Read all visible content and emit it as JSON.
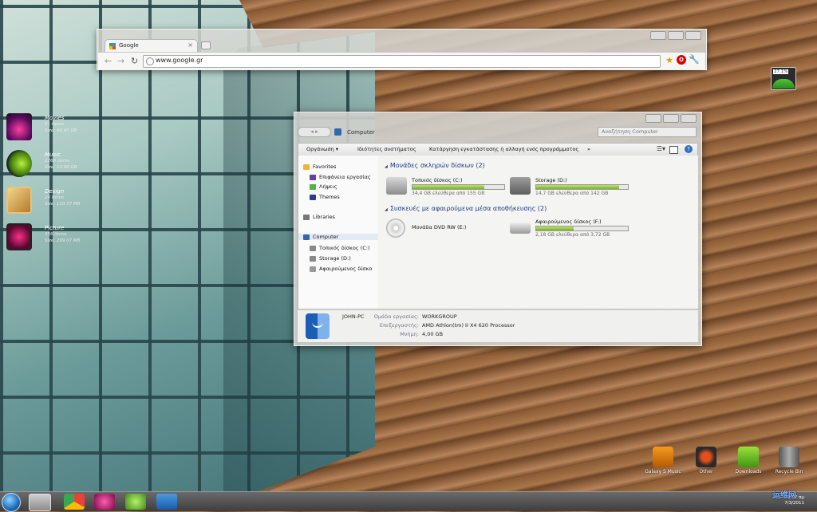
{
  "desktop": {
    "libraries": [
      {
        "name": "Movies",
        "count": "51 items",
        "size": "Size: 46.40 GB"
      },
      {
        "name": "Music",
        "count": "2260 items",
        "size": "Size: 12.99 GB"
      },
      {
        "name": "Design",
        "count": "24 items",
        "size": "Size: 110.77 MB"
      },
      {
        "name": "Picture",
        "count": "356 items",
        "size": "Size: 299.07 MB"
      }
    ],
    "widget_percent": "27.1%",
    "dock": [
      {
        "label": "Galaxy S Music"
      },
      {
        "label": "Other"
      },
      {
        "label": "Downloads"
      },
      {
        "label": "Recycle Bin"
      }
    ]
  },
  "chrome": {
    "tab_title": "Google",
    "url": "www.google.gr"
  },
  "explorer": {
    "breadcrumb": "Computer",
    "search_placeholder": "Αναζήτηση Computer",
    "toolbar": {
      "organize": "Οργάνωση ▾",
      "system_properties": "Ιδιότητες συστήματος",
      "uninstall": "Κατάργηση εγκατάστασης ή αλλαγή ενός προγράμματος",
      "more": "»"
    },
    "nav": {
      "favorites": "Favorites",
      "desktop": "Επιφάνεια εργασίας",
      "downloads": "Λήψεις",
      "themes": "Themes",
      "libraries": "Libraries",
      "computer": "Computer",
      "local_disk": "Τοπικός δίσκος (C:)",
      "storage": "Storage (D:)",
      "removable": "Αφαιρούμενος δίσκο"
    },
    "groups": {
      "hard_drives": "Μονάδες σκληρών δίσκων (2)",
      "removable": "Συσκευές με αφαιρούμενα μέσα αποθήκευσης (2)"
    },
    "drives": {
      "c": {
        "name": "Τοπικός δίσκος (C:)",
        "free": "34,4 GB ελεύθερα από 155 GB",
        "used_fraction": 0.78
      },
      "d": {
        "name": "Storage (D:)",
        "free": "14,7 GB ελεύθερα από 142 GB",
        "used_fraction": 0.9
      },
      "e": {
        "name": "Μονάδα DVD RW (E:)"
      },
      "f": {
        "name": "Αφαιρούμενος δίσκος (F:)",
        "free": "2,18 GB ελεύθερα από 3,72 GB",
        "used_fraction": 0.41
      }
    },
    "details": {
      "pc_name": "JOHN-PC",
      "workgroup_label": "Ομάδα εργασίας:",
      "workgroup": "WORKGROUP",
      "processor_label": "Επεξεργαστής:",
      "processor": "AMD Athlon(tm) II X4 620 Processor",
      "memory_label": "Μνήμη:",
      "memory": "4,00 GB"
    }
  },
  "taskbar": {
    "time": "9:57 πμ",
    "date": "7/3/2011"
  },
  "watermark": "运维网"
}
